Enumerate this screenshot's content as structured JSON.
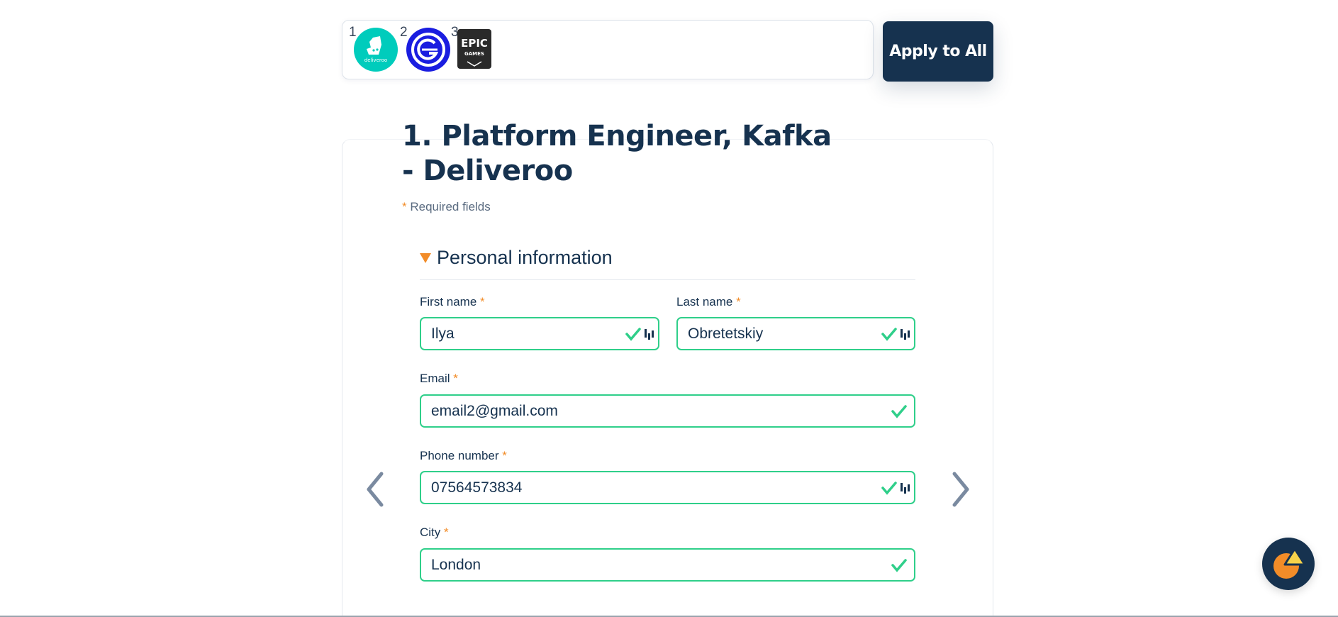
{
  "companies": [
    {
      "num": "1",
      "name": "deliveroo",
      "color": "#00ccbc",
      "icon": "deliveroo-logo-icon"
    },
    {
      "num": "2",
      "name": "",
      "color": "#1a1de0",
      "icon": "blue-g-logo-icon"
    },
    {
      "num": "3",
      "name": "EPIC GAMES",
      "color": "#2a2a2a",
      "icon": "epic-games-logo-icon"
    }
  ],
  "apply_all_label": "Apply to All",
  "job": {
    "title": "1. Platform Engineer, Kafka - Deliveroo",
    "required_star": "*",
    "required_note": "Required fields"
  },
  "section": {
    "title": "Personal information"
  },
  "fields": {
    "first_name": {
      "label": "First name",
      "value": "Ilya"
    },
    "last_name": {
      "label": "Last name",
      "value": "Obretetskiy"
    },
    "email": {
      "label": "Email",
      "value": "email2@gmail.com"
    },
    "phone": {
      "label": "Phone number",
      "value": "07564573834"
    },
    "city": {
      "label": "City",
      "value": "London"
    }
  },
  "colors": {
    "navy": "#16324f",
    "accent": "#f28c28",
    "valid": "#2fcf8a"
  }
}
